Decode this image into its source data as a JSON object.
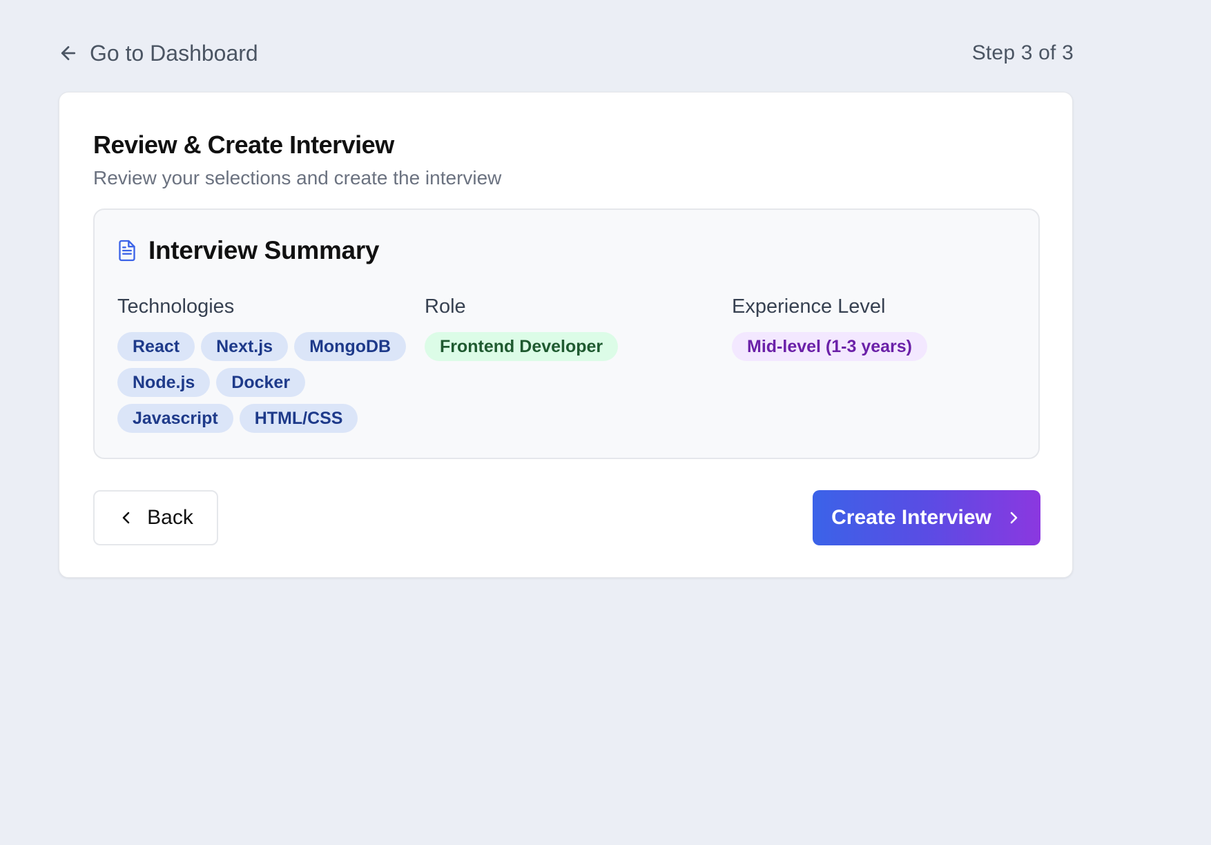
{
  "header": {
    "back_label": "Go to Dashboard",
    "step_text": "Step 3 of 3"
  },
  "card": {
    "title": "Review & Create Interview",
    "subtitle": "Review your selections and create the interview"
  },
  "summary": {
    "title": "Interview Summary",
    "icon": "document-icon",
    "technologies_label": "Technologies",
    "technologies": [
      "React",
      "Next.js",
      "MongoDB",
      "Node.js",
      "Docker",
      "Javascript",
      "HTML/CSS"
    ],
    "role_label": "Role",
    "role": "Frontend Developer",
    "experience_label": "Experience Level",
    "experience": "Mid-level (1-3 years)"
  },
  "actions": {
    "back_label": "Back",
    "create_label": "Create Interview"
  },
  "colors": {
    "background": "#ebeef5",
    "tech_chip_bg": "#dbe5f8",
    "tech_chip_text": "#1e3a8a",
    "role_chip_bg": "#dcfce7",
    "role_chip_text": "#1f5a30",
    "experience_chip_bg": "#f3e8ff",
    "experience_chip_text": "#6b21a8",
    "primary_gradient_start": "#3b63e8",
    "primary_gradient_end": "#8b38e0"
  }
}
